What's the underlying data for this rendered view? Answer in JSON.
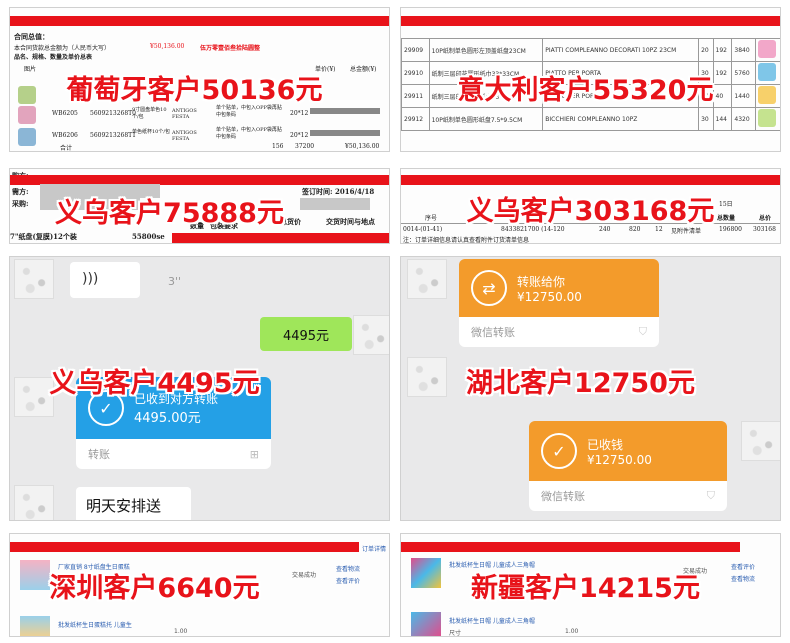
{
  "tiles": {
    "portugal": {
      "caption": "葡萄牙客户50136元",
      "lines": {
        "header": "合同总值：",
        "amount_label": "本合同货款总金额为（人民币大写）",
        "amount": "¥50,136.00",
        "red_note": "伍万零壹佰叁拾陆圆整",
        "row_title": "品名、规格、数量及单价总表",
        "col_image": "图片",
        "col_price": "单价(¥)",
        "col_total": "总金额(¥)",
        "code1": "WB6205",
        "code2": "WB6206",
        "bar1": "5609213268T0",
        "bar2": "5609213268T1",
        "desc1": "9寸圆盘单色10个/包",
        "desc2": "单色纸杯10个/包",
        "name1": "ANTIGOS FESTA",
        "name2": "ANTIGOS FESTA",
        "pack1": "单个贴单，中包入OPP袋再贴中包条码",
        "pack2": "单个贴单，中包入OPP袋再贴中包条码",
        "qty1": "20*12",
        "qty2": "20*12",
        "sum_label": "合计",
        "sum_qty": "156",
        "sum_pcs": "37200",
        "sum_amount": "¥50,136.00"
      }
    },
    "italy": {
      "caption": "意大利客户55320元",
      "rows": [
        {
          "id": "29909",
          "desc": "10P纸制单色圆形左顶盖纸盘23CM",
          "name": "PIATTI COMPLEANNO DECORATI 10PZ 23CM",
          "a": "20",
          "b": "192",
          "c": "3840"
        },
        {
          "id": "29910",
          "desc": "纸制三层印花圆形纸巾33*33CM",
          "name": "PIATTO PER PORTA",
          "a": "30",
          "b": "192",
          "c": "5760"
        },
        {
          "id": "29911",
          "desc": "纸制三层印花圆形纸巾33*33CM",
          "name": "PIATTO PER PORTA",
          "a": "30",
          "b": "40",
          "c": "1440"
        },
        {
          "id": "29912",
          "desc": "10P纸制单色圆形纸盘7.5*9.5CM",
          "name": "BICCHIERI COMPLEANNO 10PZ",
          "a": "30",
          "b": "144",
          "c": "4320"
        }
      ]
    },
    "yiwu1": {
      "caption": "义乌客户75888元",
      "lines": {
        "buyer": "购方:",
        "seller": "需方:",
        "contact": "采购:",
        "sign_time": "签订时间: 2016/4/18",
        "col_qty": "数量",
        "col_total": "总货价",
        "col_delivery": "交货时间与地点",
        "col_req": "包装要求",
        "item": "7\"纸盘(复膜)12个装",
        "item_amount": "55800se"
      }
    },
    "yiwu2": {
      "caption": "义乌客户303168元",
      "lines": {
        "date": "15日",
        "col_no": "序号",
        "col_qty": "总数量",
        "col_amount": "总价",
        "row_code": "0014-(01-41)",
        "row_sku": "8433821700 (14-120",
        "row_v1": "240",
        "row_v2": "820",
        "row_v3": "12",
        "row_pay": "见附件清单",
        "row_qty": "196800",
        "row_amount": "303168",
        "note": "注：订单详细信息请认真查看附件订货清单信息"
      }
    },
    "yiwu3": {
      "caption": "义乌客户4495元",
      "chat": {
        "time_hint": "3''",
        "sent_amount": "4495元",
        "received_title": "已收到对方转账",
        "received_amount": "4495.00元",
        "card_footer": "转账",
        "next_msg": "明天安排送"
      }
    },
    "hubei": {
      "caption": "湖北客户12750元",
      "chat": {
        "transfer_title": "转账给你",
        "transfer_amount": "¥12750.00",
        "footer": "微信转账",
        "time_hint": "5''",
        "received_title": "已收钱",
        "received_amount": "¥12750.00",
        "footer2": "微信转账"
      }
    },
    "shenzhen": {
      "caption": "深圳客户6640元",
      "shop": {
        "top_link": "订单详情",
        "store1": "厂家直销 8寸纸盘生日蛋糕",
        "status": "交易成功",
        "action1": "查看物流",
        "action2": "查看评价",
        "store2": "批发纸杯生日蛋糕托 儿童生",
        "price": "1.00"
      }
    },
    "xinjiang": {
      "caption": "新疆客户14215元",
      "shop": {
        "store1": "批发纸杯生日帽 儿童成人三角帽",
        "status": "交易成功",
        "action1": "查看评价",
        "action2": "查看物流",
        "store2": "批发纸杯生日帽 儿童成人三角帽",
        "size": "尺寸",
        "price": "1.00"
      }
    }
  },
  "colors": {
    "accent_red": "#e8131a",
    "wechat_blue": "#24a0e6",
    "wechat_orange": "#f39b2b",
    "chat_green": "#9fe65a"
  }
}
